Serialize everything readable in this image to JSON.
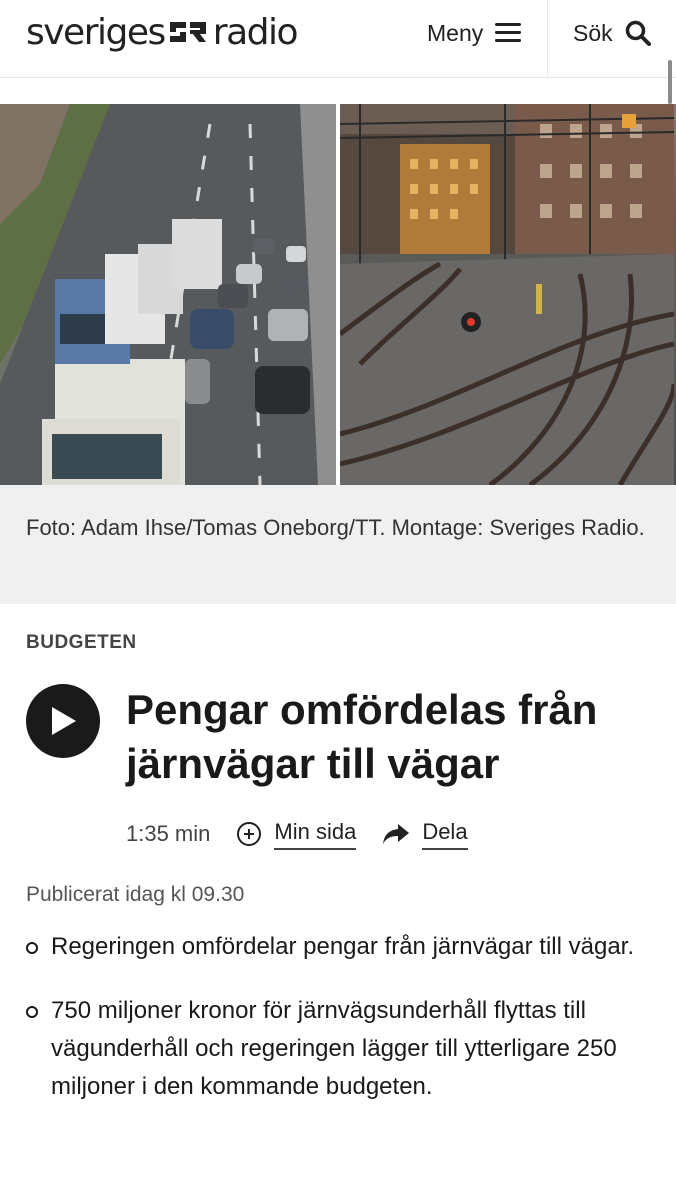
{
  "header": {
    "logo_text_a": "sveriges",
    "logo_text_b": "radio",
    "menu_label": "Meny",
    "search_label": "Sök"
  },
  "image": {
    "caption": "Foto: Adam Ihse/Tomas Oneborg/TT. Montage: Sveriges Radio."
  },
  "article": {
    "category": "BUDGETEN",
    "title": "Pengar omfördelas från järnvägar till vägar",
    "duration": "1:35 min",
    "my_page_label": "Min sida",
    "share_label": "Dela",
    "published": "Publicerat idag kl 09.30",
    "bullets": [
      "Regeringen omfördelar pengar från järnvägar till vägar.",
      "750 miljoner kronor för järnvägsunderhåll flyttas till vägunderhåll och regeringen lägger till ytterligare 250 miljoner i den kommande budgeten."
    ]
  },
  "colors": {
    "text": "#1a1a1a",
    "caption_bg": "#f0f0f0",
    "play_bg": "#1a1a1a"
  },
  "icons": {
    "menu": "hamburger-icon",
    "search": "search-icon",
    "play": "play-icon",
    "add": "plus-circle-icon",
    "share": "share-arrow-icon"
  }
}
